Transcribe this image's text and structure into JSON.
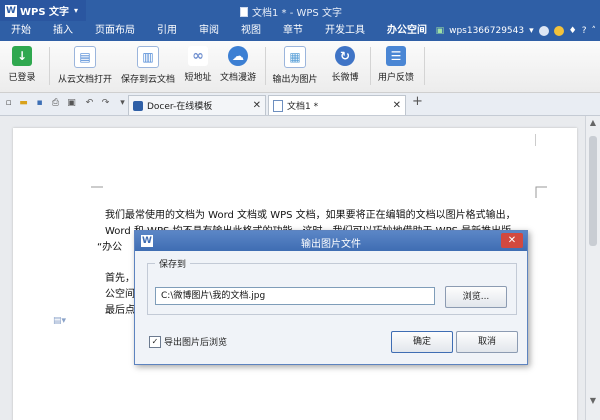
{
  "titlebar": {
    "app_name": "WPS 文字",
    "title": "文档1 * - WPS 文字",
    "controls": {
      "minimize": "–",
      "maximize": "□",
      "close": "✕"
    }
  },
  "menubar": {
    "items": [
      "开始",
      "插入",
      "页面布局",
      "引用",
      "审阅",
      "视图",
      "章节",
      "开发工具",
      "办公空间"
    ],
    "active_index": 8,
    "account": "wps1366729543"
  },
  "ribbon": {
    "buttons": [
      {
        "label": "已登录",
        "icon": "account-icon",
        "color": "#2fa84f"
      },
      {
        "label": "从云文档打开",
        "icon": "cloud-open-icon",
        "color": "#4a86d4"
      },
      {
        "label": "保存到云文档",
        "icon": "cloud-save-icon",
        "color": "#4a86d4"
      },
      {
        "label": "短地址",
        "icon": "link-icon",
        "color": "#6f8fcf"
      },
      {
        "label": "文档漫游",
        "icon": "cloud-icon",
        "color": "#3c7fd3"
      },
      {
        "label": "输出为图片",
        "icon": "export-image-icon",
        "color": "#5aa0d8"
      },
      {
        "label": "长微博",
        "icon": "weibo-icon",
        "color": "#3f74c6"
      },
      {
        "label": "用户反馈",
        "icon": "feedback-icon",
        "color": "#4a86d4"
      }
    ]
  },
  "tabs": [
    {
      "label": "Docer-在线模板",
      "icon": "docer-icon"
    },
    {
      "label": "文档1 *",
      "icon": "document-icon"
    }
  ],
  "document": {
    "lines": [
      "我们最常使用的文档为 Word 文档或 WPS 文档，如果要将正在编辑的文档以图片格式输出，",
      "Word 和 WPS 均不具有输出此格式的功能，这时，我们可以巧妙地借助于 WPS 最新推出版",
      "“办公",
      "首先，",
      "公空间",
      "最后点"
    ]
  },
  "dialog": {
    "title": "输出图片文件",
    "group_label": "保存到",
    "path_value": "C:\\微博图片\\我的文档.jpg",
    "browse_label": "浏览...",
    "checkbox_label": "导出图片后浏览",
    "checkbox_checked": true,
    "ok_label": "确定",
    "cancel_label": "取消",
    "close_glyph": "✕"
  }
}
